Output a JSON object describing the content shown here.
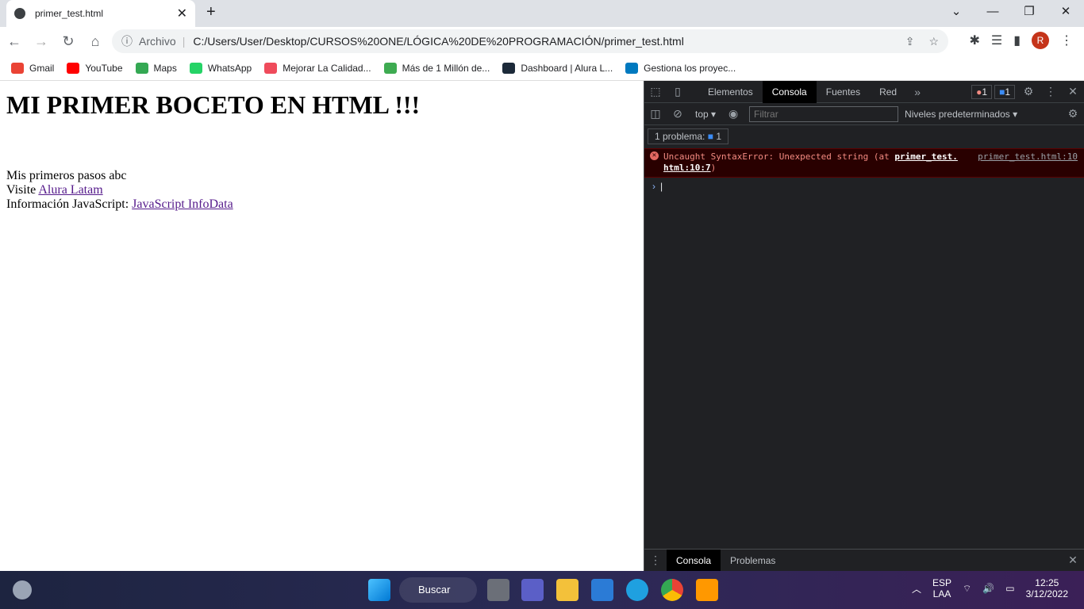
{
  "browser": {
    "tab_title": "primer_test.html",
    "address_prefix": "Archivo",
    "url": "C:/Users/User/Desktop/CURSOS%20ONE/LÓGICA%20DE%20PROGRAMACIÓN/primer_test.html",
    "avatar_letter": "R"
  },
  "bookmarks": [
    {
      "label": "Gmail",
      "color": "#ea4335"
    },
    {
      "label": "YouTube",
      "color": "#ff0000"
    },
    {
      "label": "Maps",
      "color": "#34a853"
    },
    {
      "label": "WhatsApp",
      "color": "#25d366"
    },
    {
      "label": "Mejorar La Calidad...",
      "color": "#ef4b5b"
    },
    {
      "label": "Más de 1 Millón de...",
      "color": "#3eab51"
    },
    {
      "label": "Dashboard | Alura L...",
      "color": "#1c2a39"
    },
    {
      "label": "Gestiona los proyec...",
      "color": "#0079bf"
    }
  ],
  "page": {
    "heading": "MI PRIMER BOCETO EN HTML !!!",
    "line1": "Mis primeros pasos abc",
    "line2_prefix": "Visite ",
    "link1": "Alura Latam",
    "line3_prefix": "Información JavaScript: ",
    "link2": "JavaScript InfoData"
  },
  "devtools": {
    "tabs": [
      "Elementos",
      "Consola",
      "Fuentes",
      "Red"
    ],
    "active_tab": "Consola",
    "error_count": "1",
    "issue_count": "1",
    "context": "top",
    "filter_placeholder": "Filtrar",
    "levels": "Niveles predeterminados",
    "problems_label": "1 problema:",
    "problems_count": "1",
    "error": {
      "message": "Uncaught SyntaxError: Unexpected string (at ",
      "link": "primer_test.",
      "link_cont": "html:10:7",
      "close": ")",
      "source": "primer_test.html:10"
    },
    "drawer_tabs": [
      "Consola",
      "Problemas"
    ]
  },
  "taskbar": {
    "search": "Buscar",
    "lang": "ESP",
    "layout": "LAA",
    "time": "12:25",
    "date": "3/12/2022"
  }
}
